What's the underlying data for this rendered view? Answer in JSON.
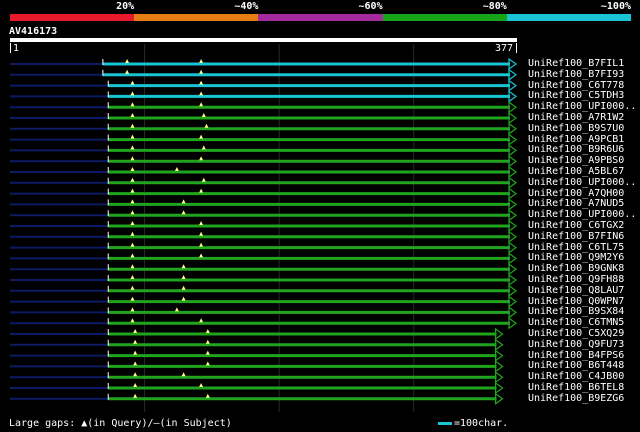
{
  "legend": {
    "segments": [
      {
        "label": "20%",
        "color": "#e8192c"
      },
      {
        "label": "~40%",
        "color": "#e67c16"
      },
      {
        "label": "~60%",
        "color": "#a42a9e"
      },
      {
        "label": "~80%",
        "color": "#16a418"
      },
      {
        "label": "~100%",
        "color": "#19c5d4"
      }
    ]
  },
  "query": {
    "title": "AV416173",
    "start_label": "1",
    "end_label": "377",
    "length": 377
  },
  "colors": {
    "cyan": "#19c5d4",
    "green": "#22a51e",
    "navy": "#0d1a66",
    "gap_marker": "#ffff80",
    "grid": "#2a2a2a"
  },
  "hits": [
    {
      "name": "UniRef100_B7FIL1",
      "start": 70,
      "end": 377,
      "color": "cyan",
      "arrow": true,
      "gaps": [
        88,
        143
      ]
    },
    {
      "name": "UniRef100_B7FI93",
      "start": 70,
      "end": 377,
      "color": "cyan",
      "arrow": true,
      "gaps": [
        88,
        143
      ]
    },
    {
      "name": "UniRef100_C6T778",
      "start": 74,
      "end": 377,
      "color": "cyan",
      "arrow": true,
      "gaps": [
        92,
        143
      ]
    },
    {
      "name": "UniRef100_C5TDH3",
      "start": 74,
      "end": 377,
      "color": "cyan",
      "arrow": true,
      "gaps": [
        92,
        143
      ]
    },
    {
      "name": "UniRef100_UPI000..",
      "start": 74,
      "end": 377,
      "color": "green",
      "arrow": true,
      "gaps": [
        92,
        143
      ]
    },
    {
      "name": "UniRef100_A7R1W2",
      "start": 74,
      "end": 377,
      "color": "green",
      "arrow": true,
      "gaps": [
        92,
        145
      ]
    },
    {
      "name": "UniRef100_B9S7U0",
      "start": 74,
      "end": 377,
      "color": "green",
      "arrow": true,
      "gaps": [
        92,
        147
      ]
    },
    {
      "name": "UniRef100_A9PCB1",
      "start": 74,
      "end": 377,
      "color": "green",
      "arrow": true,
      "gaps": [
        92,
        143
      ]
    },
    {
      "name": "UniRef100_B9R6U6",
      "start": 74,
      "end": 377,
      "color": "green",
      "arrow": true,
      "gaps": [
        92,
        145
      ]
    },
    {
      "name": "UniRef100_A9PBS0",
      "start": 74,
      "end": 377,
      "color": "green",
      "arrow": true,
      "gaps": [
        92,
        143
      ]
    },
    {
      "name": "UniRef100_A5BL67",
      "start": 74,
      "end": 377,
      "color": "green",
      "arrow": true,
      "gaps": [
        92,
        125
      ]
    },
    {
      "name": "UniRef100_UPI000..",
      "start": 74,
      "end": 377,
      "color": "green",
      "arrow": true,
      "gaps": [
        92,
        145
      ]
    },
    {
      "name": "UniRef100_A7QH00",
      "start": 74,
      "end": 377,
      "color": "green",
      "arrow": true,
      "gaps": [
        92,
        143
      ]
    },
    {
      "name": "UniRef100_A7NUD5",
      "start": 74,
      "end": 377,
      "color": "green",
      "arrow": true,
      "gaps": [
        92,
        130
      ]
    },
    {
      "name": "UniRef100_UPI000..",
      "start": 74,
      "end": 377,
      "color": "green",
      "arrow": true,
      "gaps": [
        92,
        130
      ]
    },
    {
      "name": "UniRef100_C6TGX2",
      "start": 74,
      "end": 377,
      "color": "green",
      "arrow": true,
      "gaps": [
        92,
        143
      ]
    },
    {
      "name": "UniRef100_B7FIN6",
      "start": 74,
      "end": 377,
      "color": "green",
      "arrow": true,
      "gaps": [
        92,
        143
      ]
    },
    {
      "name": "UniRef100_C6TL75",
      "start": 74,
      "end": 377,
      "color": "green",
      "arrow": true,
      "gaps": [
        92,
        143
      ]
    },
    {
      "name": "UniRef100_Q9M2Y6",
      "start": 74,
      "end": 377,
      "color": "green",
      "arrow": true,
      "gaps": [
        92,
        143
      ]
    },
    {
      "name": "UniRef100_B9GNK8",
      "start": 74,
      "end": 377,
      "color": "green",
      "arrow": true,
      "gaps": [
        92,
        130
      ]
    },
    {
      "name": "UniRef100_Q9FH88",
      "start": 74,
      "end": 377,
      "color": "green",
      "arrow": true,
      "gaps": [
        92,
        130
      ]
    },
    {
      "name": "UniRef100_Q8LAU7",
      "start": 74,
      "end": 377,
      "color": "green",
      "arrow": true,
      "gaps": [
        92,
        130
      ]
    },
    {
      "name": "UniRef100_Q0WPN7",
      "start": 74,
      "end": 377,
      "color": "green",
      "arrow": true,
      "gaps": [
        92,
        130
      ]
    },
    {
      "name": "UniRef100_B9SX84",
      "start": 74,
      "end": 377,
      "color": "green",
      "arrow": true,
      "gaps": [
        92,
        125
      ]
    },
    {
      "name": "UniRef100_C6TMN5",
      "start": 74,
      "end": 377,
      "color": "green",
      "arrow": true,
      "gaps": [
        92,
        143
      ]
    },
    {
      "name": "UniRef100_C5XQ29",
      "start": 74,
      "end": 367,
      "color": "green",
      "arrow": true,
      "gaps": [
        94,
        148
      ]
    },
    {
      "name": "UniRef100_Q9FU73",
      "start": 74,
      "end": 367,
      "color": "green",
      "arrow": true,
      "gaps": [
        94,
        148
      ]
    },
    {
      "name": "UniRef100_B4FPS6",
      "start": 74,
      "end": 367,
      "color": "green",
      "arrow": true,
      "gaps": [
        94,
        148
      ]
    },
    {
      "name": "UniRef100_B6T448",
      "start": 74,
      "end": 367,
      "color": "green",
      "arrow": true,
      "gaps": [
        94,
        148
      ]
    },
    {
      "name": "UniRef100_C4JB00",
      "start": 74,
      "end": 367,
      "color": "green",
      "arrow": true,
      "gaps": [
        94,
        130
      ]
    },
    {
      "name": "UniRef100_B6TEL8",
      "start": 74,
      "end": 367,
      "color": "green",
      "arrow": true,
      "gaps": [
        94,
        143
      ]
    },
    {
      "name": "UniRef100_B9EZG6",
      "start": 74,
      "end": 367,
      "color": "green",
      "arrow": true,
      "gaps": [
        94,
        148
      ]
    }
  ],
  "footer": {
    "large_gaps_text": "Large gaps: ▲(in Query)/–(in Subject)",
    "scale_text": "=100char."
  }
}
